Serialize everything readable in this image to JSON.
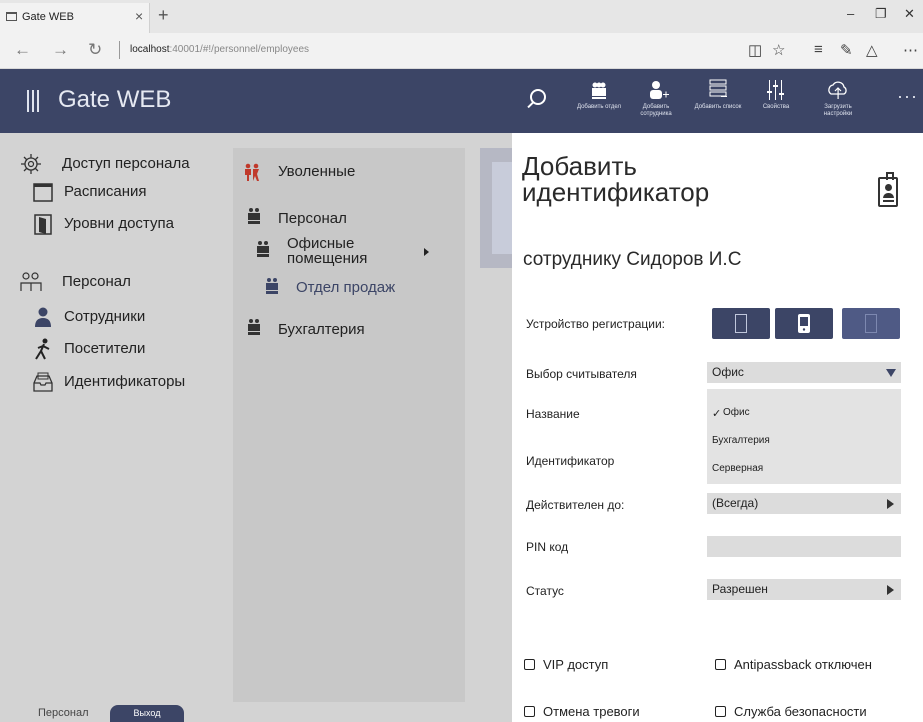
{
  "browser": {
    "tab_title": "Gate WEB",
    "tab_close": "×",
    "new_tab": "+",
    "url_host": "localhost",
    "url_rest": ":40001/#!/personnel/employees",
    "win_min": "–",
    "win_max": "❐",
    "win_close": "✕",
    "back": "←",
    "forward": "→",
    "refresh": "↻",
    "tools": [
      "reading-view-icon",
      "favorite-star-icon",
      "hub-icon",
      "web-note-icon",
      "share-icon",
      "more-icon"
    ]
  },
  "header": {
    "title": "Gate WEB",
    "more": "···",
    "toolbar": [
      {
        "label": "Добавить отдел",
        "icon": "add-department-icon"
      },
      {
        "label": "Добавить сотрудника",
        "icon": "add-employee-icon"
      },
      {
        "label": "Добавить список",
        "icon": "add-list-icon"
      },
      {
        "label": "Свойства",
        "icon": "properties-icon"
      },
      {
        "label": "Загрузить настройки",
        "icon": "upload-settings-icon"
      }
    ]
  },
  "sidebar": {
    "items": [
      {
        "label": "Доступ персонала",
        "icon": "gear-icon"
      },
      {
        "label": "Расписания",
        "icon": "calendar-icon"
      },
      {
        "label": "Уровни доступа",
        "icon": "door-icon"
      },
      {
        "label": "Персонал",
        "icon": "people-icon"
      },
      {
        "label": "Сотрудники",
        "icon": "employee-icon"
      },
      {
        "label": "Посетители",
        "icon": "walker-icon"
      },
      {
        "label": "Идентификаторы",
        "icon": "card-tray-icon"
      }
    ],
    "footer_user": "Персонал",
    "logout": "Выход"
  },
  "departments": {
    "items": [
      {
        "label": "Уволенные"
      },
      {
        "label": "Персонал"
      },
      {
        "label": "Офисные помещения"
      },
      {
        "label": "Отдел продаж"
      },
      {
        "label": "Бухгалтерия"
      }
    ]
  },
  "form": {
    "title": "Добавить идентификатор",
    "subtitle": "сотруднику Сидоров И.С",
    "labels": {
      "device": "Устройство регистрации:",
      "reader": "Выбор считывателя",
      "name": "Название",
      "identifier": "Идентификатор",
      "valid_until": "Действителен до:",
      "pin": "PIN код",
      "status": "Статус"
    },
    "reader_value": "Офис",
    "reader_options": [
      "Офис",
      "Бухгалтерия",
      "Серверная"
    ],
    "reader_selected_mark": "✓",
    "valid_until_value": "(Всегда)",
    "pin_value": "",
    "status_value": "Разрешен",
    "checkboxes": [
      {
        "label": "VIP доступ",
        "checked": false
      },
      {
        "label": "Antipassback отключен",
        "checked": false
      },
      {
        "label": "Отмена тревоги",
        "checked": false
      },
      {
        "label": "Служба безопасности",
        "checked": false
      }
    ]
  },
  "colors": {
    "header_bg": "#3c4566",
    "sidebar_bg": "#d3d3d3",
    "panel_bg": "#c8c8c8"
  }
}
